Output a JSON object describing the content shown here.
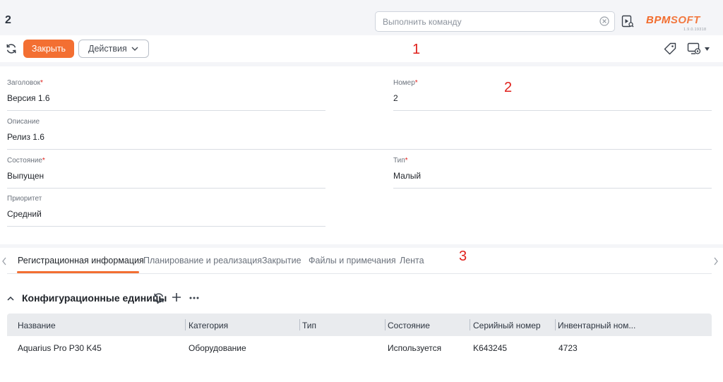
{
  "header": {
    "page_number": "2",
    "command_placeholder": "Выполнить команду",
    "logo_text_1": "BPM",
    "logo_text_2": "SOFT",
    "version": "1.9.0.19318"
  },
  "toolbar": {
    "close_label": "Закрыть",
    "actions_label": "Действия"
  },
  "annotations": {
    "mark_1": "1",
    "mark_2": "2",
    "mark_3": "3"
  },
  "form": {
    "title": {
      "label": "Заголовок",
      "required": "*",
      "value": "Версия 1.6"
    },
    "number": {
      "label": "Номер",
      "required": "*",
      "value": "2"
    },
    "description": {
      "label": "Описание",
      "value": "Релиз 1.6"
    },
    "state": {
      "label": "Состояние",
      "required": "*",
      "value": "Выпущен"
    },
    "type": {
      "label": "Тип",
      "required": "*",
      "value": "Малый"
    },
    "priority": {
      "label": "Приоритет",
      "value": "Средний"
    }
  },
  "tabs": [
    {
      "label": "Регистрационная информация",
      "active": true
    },
    {
      "label": "Планирование и реализация"
    },
    {
      "label": "Закрытие"
    },
    {
      "label": "Файлы и примечания"
    },
    {
      "label": "Лента"
    }
  ],
  "section": {
    "title": "Конфигурационные единицы",
    "columns": [
      "Название",
      "Категория",
      "Тип",
      "Состояние",
      "Серийный номер",
      "Инвентарный ном..."
    ],
    "rows": [
      [
        "Aquarius Pro P30 K45",
        "Оборудование",
        "",
        "Используется",
        "K643245",
        "4723"
      ]
    ]
  },
  "colors": {
    "accent": "#f36f32",
    "required": "#e0201b",
    "logo": "#f26c2d"
  }
}
